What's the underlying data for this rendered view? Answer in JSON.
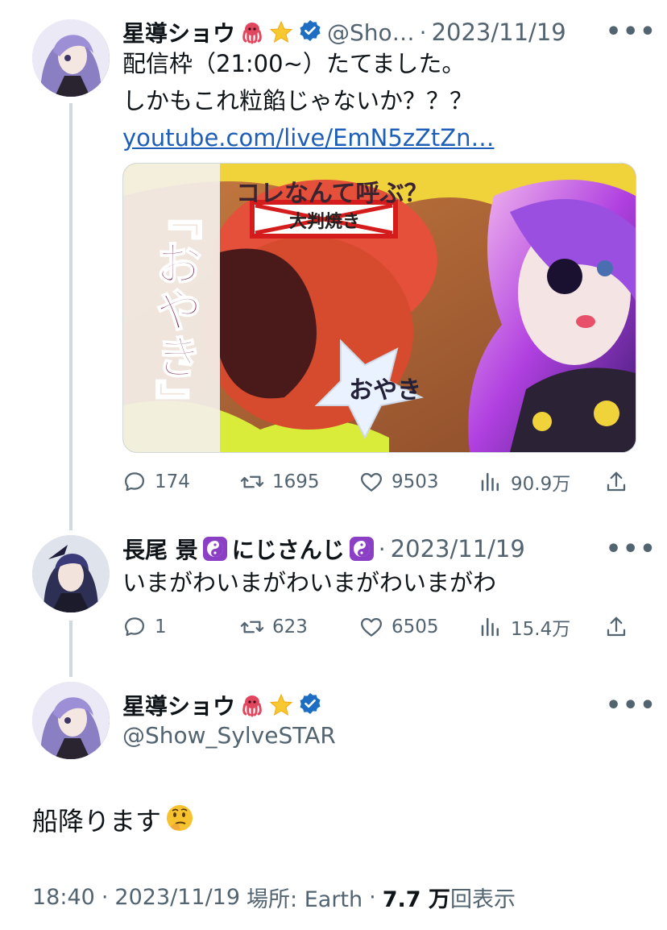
{
  "tweet1": {
    "name": "星導ショウ",
    "handle": "@Sho…",
    "separator": "·",
    "date": "2023/11/19",
    "more": "•••",
    "line1": "配信枠（21:00~）たてました。",
    "line2": "しかもこれ粒餡じゃないか？？？",
    "link": "youtube.com/live/EmN5zZtZn…",
    "thumbnail": {
      "headline": "コレなんて呼ぶ？",
      "vertical_text": "『おやき』",
      "crossed_label": "大判焼き",
      "bubble_text": "おやき"
    },
    "stats": {
      "replies": "174",
      "retweets": "1695",
      "likes": "9503",
      "views": "90.9万"
    }
  },
  "tweet2": {
    "name": "長尾 景",
    "name_suffix": "にじさんじ",
    "separator": "·",
    "date": "2023/11/19",
    "more": "•••",
    "text": "いまがわいまがわいまがわいまがわ",
    "stats": {
      "replies": "1",
      "retweets": "623",
      "likes": "6505",
      "views": "15.4万"
    }
  },
  "main": {
    "name": "星導ショウ",
    "handle": "@Show_SylveSTAR",
    "more": "•••",
    "text": "船降ります",
    "time": "18:40",
    "date": "2023/11/19",
    "location_label": "場所: Earth",
    "views_count": "7.7 万",
    "views_label": "回表示",
    "separator": "·"
  },
  "icons": [
    "octopus-emoji",
    "star-emoji",
    "verified-badge-icon",
    "yin-yang-emoji",
    "thinking-emoji",
    "reply-icon",
    "retweet-icon",
    "like-icon",
    "views-icon",
    "share-icon",
    "more-icon"
  ],
  "colors": {
    "verified": "#1d6dc2",
    "link": "#1d5fb8",
    "muted": "#536471",
    "line": "#cfd9de",
    "yin_yang_bg": "#8b3fc5"
  }
}
